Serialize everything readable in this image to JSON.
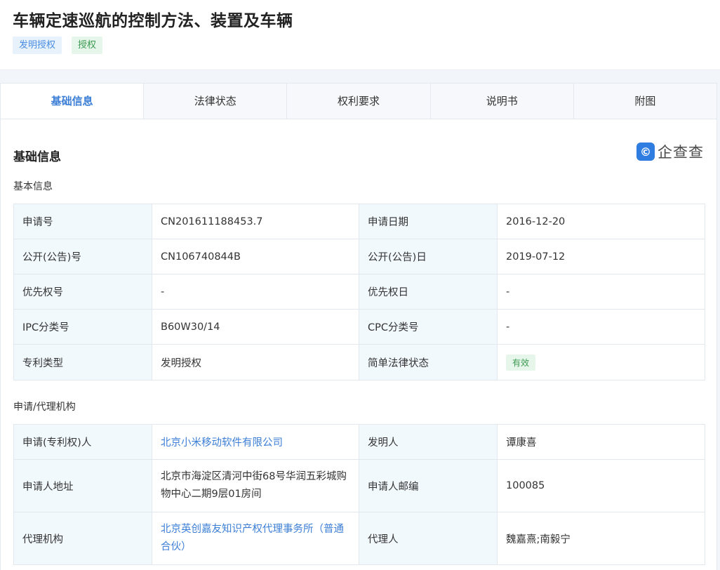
{
  "header": {
    "title": "车辆定速巡航的控制方法、装置及车辆",
    "tags": [
      "发明授权",
      "授权"
    ]
  },
  "tabs": [
    {
      "label": "基础信息",
      "active": true
    },
    {
      "label": "法律状态",
      "active": false
    },
    {
      "label": "权利要求",
      "active": false
    },
    {
      "label": "说明书",
      "active": false
    },
    {
      "label": "附图",
      "active": false
    }
  ],
  "section": {
    "title": "基础信息",
    "brand": {
      "mark": "©",
      "text": "企查查"
    }
  },
  "basic": {
    "title": "基本信息",
    "rows": [
      {
        "l1": "申请号",
        "v1": "CN201611188453.7",
        "l2": "申请日期",
        "v2": "2016-12-20"
      },
      {
        "l1": "公开(公告)号",
        "v1": "CN106740844B",
        "l2": "公开(公告)日",
        "v2": "2019-07-12"
      },
      {
        "l1": "优先权号",
        "v1": "-",
        "l2": "优先权日",
        "v2": "-"
      },
      {
        "l1": "IPC分类号",
        "v1": "B60W30/14",
        "l2": "CPC分类号",
        "v2": "-"
      },
      {
        "l1": "专利类型",
        "v1": "发明授权",
        "l2": "简单法律状态",
        "v2": "有效"
      }
    ]
  },
  "agency": {
    "title": "申请/代理机构",
    "rows": [
      {
        "l1": "申请(专利权)人",
        "v1": "北京小米移动软件有限公司",
        "l2": "发明人",
        "v2": "谭康喜"
      },
      {
        "l1": "申请人地址",
        "v1": "北京市海淀区清河中街68号华润五彩城购物中心二期9层01房间",
        "l2": "申请人邮编",
        "v2": "100085"
      },
      {
        "l1": "代理机构",
        "v1": "北京英创嘉友知识产权代理事务所（普通合伙）",
        "l2": "代理人",
        "v2": "魏嘉熹;南毅宁"
      }
    ]
  },
  "colors": {
    "accent": "#3d7fd6",
    "label_bg": "#f2f9fd",
    "tag_green": "#3b9a52"
  }
}
